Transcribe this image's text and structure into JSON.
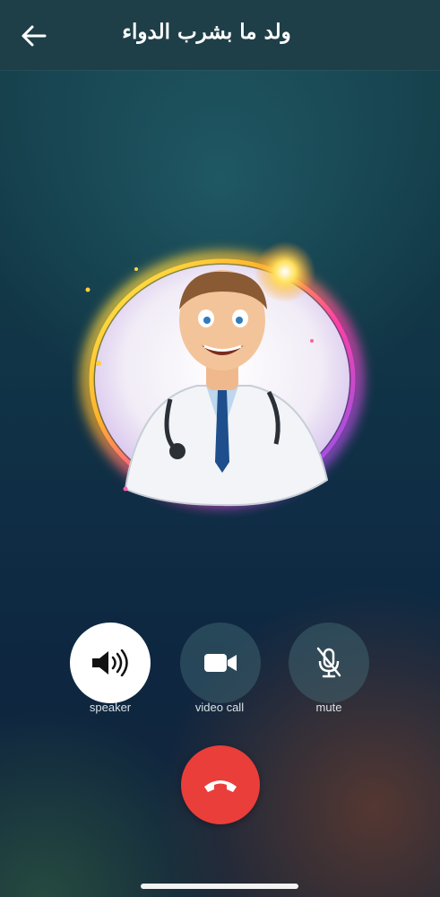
{
  "header": {
    "title": "ولد ما بشرب الدواء",
    "back_icon": "arrow-left-icon"
  },
  "call": {
    "avatar_description_icon": "doctor-avatar",
    "controls": [
      {
        "id": "speaker",
        "label": "speaker",
        "icon": "speaker-icon",
        "active": true
      },
      {
        "id": "video",
        "label": "video call",
        "icon": "video-camera-icon",
        "active": false
      },
      {
        "id": "mute",
        "label": "mute",
        "icon": "microphone-off-icon",
        "active": false
      }
    ],
    "end_call_icon": "phone-hangup-icon"
  },
  "colors": {
    "end_call": "#ea3e3a",
    "header_bg": "#1f3f48",
    "control_bg": "#466e78"
  }
}
